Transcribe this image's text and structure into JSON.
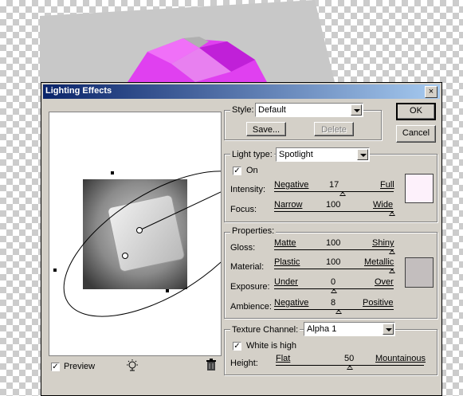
{
  "dialog": {
    "title": "Lighting Effects",
    "close_glyph": "×",
    "ok_label": "OK",
    "cancel_label": "Cancel"
  },
  "style": {
    "label": "Style:",
    "value": "Default",
    "save_label": "Save...",
    "delete_label": "Delete"
  },
  "light": {
    "type_label": "Light type:",
    "type_value": "Spotlight",
    "on_label": "On",
    "on_checked": true,
    "intensity": {
      "label": "Intensity:",
      "min": "Negative",
      "value": "17",
      "max": "Full",
      "level": 0.59
    },
    "focus": {
      "label": "Focus:",
      "min": "Narrow",
      "value": "100",
      "max": "Wide",
      "level": 1.0
    },
    "color": "#fdf1fb"
  },
  "properties": {
    "label": "Properties:",
    "gloss": {
      "label": "Gloss:",
      "min": "Matte",
      "value": "100",
      "max": "Shiny",
      "level": 1.0
    },
    "material": {
      "label": "Material:",
      "min": "Plastic",
      "value": "100",
      "max": "Metallic",
      "level": 1.0
    },
    "exposure": {
      "label": "Exposure:",
      "min": "Under",
      "value": "0",
      "max": "Over",
      "level": 0.5
    },
    "ambience": {
      "label": "Ambience:",
      "min": "Negative",
      "value": "8",
      "max": "Positive",
      "level": 0.54
    },
    "color": "#c3bebe"
  },
  "texture": {
    "label": "Texture Channel:",
    "channel_value": "Alpha 1",
    "white_high_label": "White is high",
    "white_high_checked": true,
    "height": {
      "label": "Height:",
      "min": "Flat",
      "value": "50",
      "max": "Mountainous",
      "level": 0.5
    }
  },
  "preview": {
    "label": "Preview",
    "checked": true,
    "light_icon": "light-bulb-icon",
    "trash_icon": "trash-icon"
  }
}
